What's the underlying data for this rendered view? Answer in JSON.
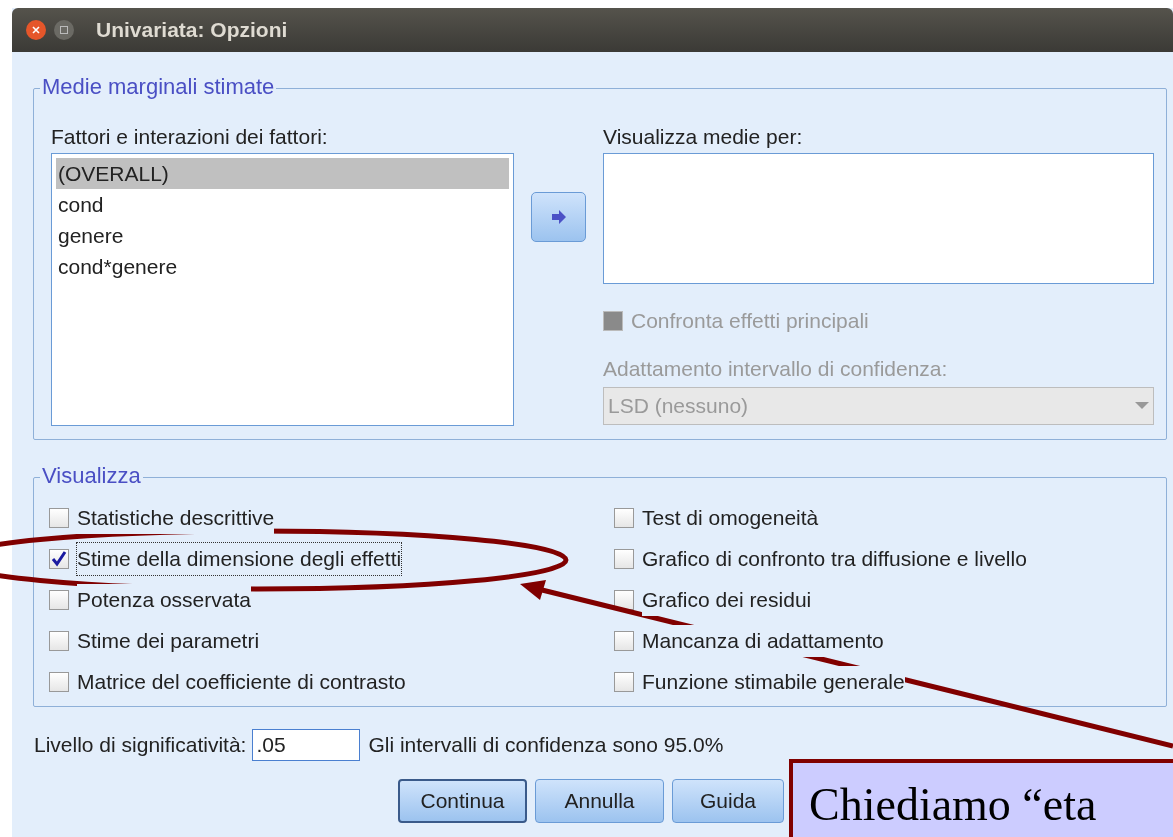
{
  "window": {
    "title": "Univariata: Opzioni"
  },
  "estimated_marginal_means": {
    "title": "Medie marginali stimate",
    "factors_label": "Fattori e interazioni dei fattori:",
    "factors": [
      {
        "label": "(OVERALL)",
        "selected": true
      },
      {
        "label": "cond",
        "selected": false
      },
      {
        "label": "genere",
        "selected": false
      },
      {
        "label": "cond*genere",
        "selected": false
      }
    ],
    "display_means_label": "Visualizza medie per:",
    "compare_main_effects": {
      "label": "Confronta effetti principali",
      "checked": false,
      "disabled": true
    },
    "ci_adjustment_label": "Adattamento intervallo di confidenza:",
    "ci_adjustment": {
      "value": "LSD (nessuno)",
      "disabled": true
    }
  },
  "display": {
    "title": "Visualizza",
    "left": [
      {
        "label": "Statistiche descrittive",
        "checked": false
      },
      {
        "label": "Stime della dimensione degli effetti",
        "checked": true
      },
      {
        "label": "Potenza osservata",
        "checked": false
      },
      {
        "label": "Stime dei parametri",
        "checked": false
      },
      {
        "label": "Matrice del coefficiente di contrasto",
        "checked": false
      }
    ],
    "right": [
      {
        "label": "Test di omogeneità",
        "checked": false
      },
      {
        "label": "Grafico di confronto tra diffusione e livello",
        "checked": false
      },
      {
        "label": "Grafico dei residui",
        "checked": false
      },
      {
        "label": "Mancanza di adattamento",
        "checked": false
      },
      {
        "label": "Funzione stimabile generale",
        "checked": false
      }
    ]
  },
  "significance": {
    "label": "Livello di significatività:",
    "value": ".05",
    "note": "Gli intervalli di confidenza sono 95.0%"
  },
  "buttons": [
    {
      "label": "Continua",
      "selected": true
    },
    {
      "label": "Annulla",
      "selected": false
    },
    {
      "label": "Guida",
      "selected": false
    }
  ],
  "callout": {
    "text": "Chiediamo “eta"
  }
}
